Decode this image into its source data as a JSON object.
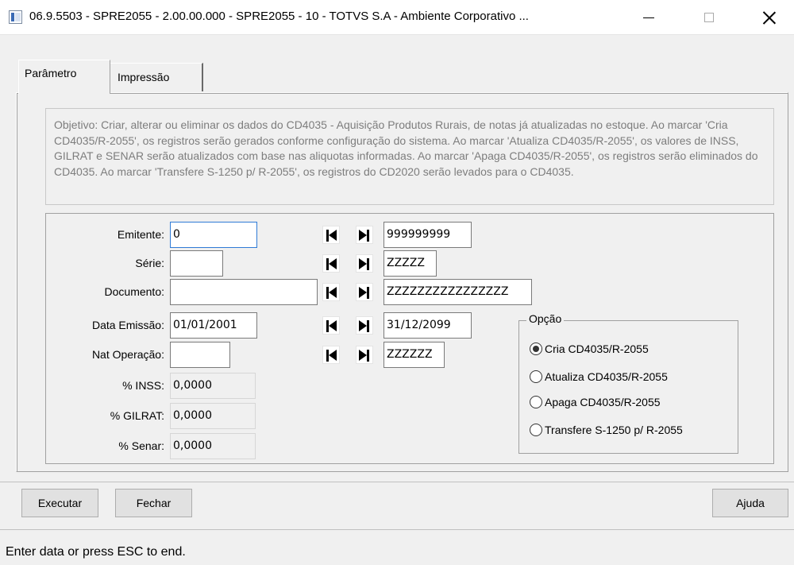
{
  "window": {
    "title": "06.9.5503 - SPRE2055 - 2.00.00.000 - SPRE2055 - 10 - TOTVS S.A - Ambiente Corporativo ...",
    "icon": "program-window-icon"
  },
  "tabs": [
    {
      "label": "Parâmetro",
      "active": true
    },
    {
      "label": "Impressão",
      "active": false
    }
  ],
  "objective": "Objetivo: Criar, alterar ou eliminar os dados do CD4035 - Aquisição Produtos Rurais, de notas já atualizadas no estoque. Ao marcar 'Cria CD4035/R-2055', os registros serão gerados conforme configuração do sistema. Ao marcar 'Atualiza CD4035/R-2055', os valores de INSS, GILRAT e SENAR serão atualizados com base nas aliquotas informadas. Ao marcar 'Apaga CD4035/R-2055', os registros serão eliminados do CD4035. Ao marcar 'Transfere S-1250 p/ R-2055', os registros do CD2020 serão levados para o CD4035.",
  "fields": {
    "emitente": {
      "label": "Emitente:",
      "from": "0",
      "to": "999999999"
    },
    "serie": {
      "label": "Série:",
      "from": "",
      "to": "ZZZZZ"
    },
    "documento": {
      "label": "Documento:",
      "from": "",
      "to": "ZZZZZZZZZZZZZZZZ"
    },
    "data_emissao": {
      "label": "Data Emissão:",
      "from": "01/01/2001",
      "to": "31/12/2099"
    },
    "nat_operacao": {
      "label": "Nat Operação:",
      "from": "",
      "to": "ZZZZZZ"
    },
    "inss": {
      "label": "% INSS:",
      "value": "0,0000"
    },
    "gilrat": {
      "label": "% GILRAT:",
      "value": "0,0000"
    },
    "senar": {
      "label": "% Senar:",
      "value": "0,0000"
    }
  },
  "option_group": {
    "title": "Opção",
    "options": [
      {
        "label": "Cria CD4035/R-2055",
        "selected": true
      },
      {
        "label": "Atualiza CD4035/R-2055",
        "selected": false
      },
      {
        "label": "Apaga CD4035/R-2055",
        "selected": false
      },
      {
        "label": "Transfere S-1250 p/ R-2055",
        "selected": false
      }
    ]
  },
  "buttons": {
    "executar": "Executar",
    "fechar": "Fechar",
    "ajuda": "Ajuda"
  },
  "status": "Enter data or press ESC to end.",
  "colors": {
    "focus_border": "#2f7bd6",
    "objective_text": "#7d7d7d",
    "window_bg": "#f0f0f0"
  }
}
